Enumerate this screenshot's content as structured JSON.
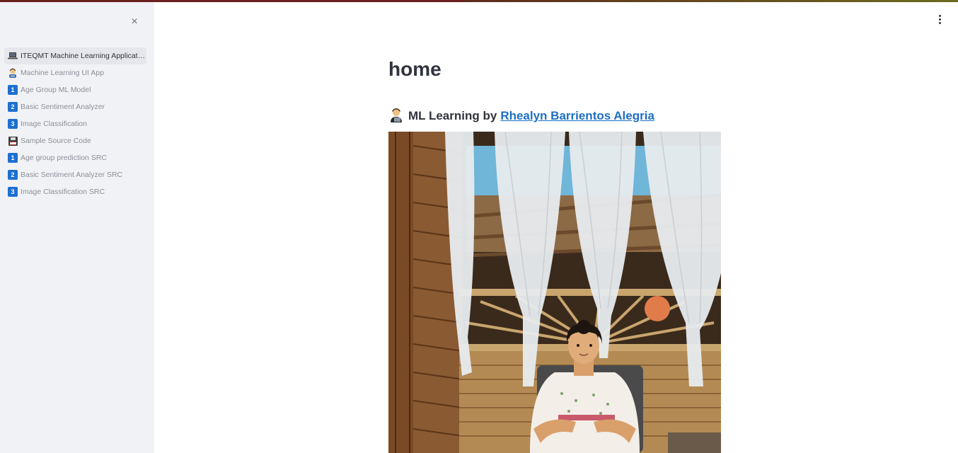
{
  "sidebar": {
    "items": [
      {
        "label": "ITEQMT Machine Learning Applicati…",
        "icon": "laptop-icon",
        "active": true
      },
      {
        "label": "Machine Learning UI App",
        "icon": "person-icon"
      },
      {
        "label": "Age Group ML Model",
        "icon": "keycap-1-icon",
        "badge": "1"
      },
      {
        "label": "Basic Sentiment Analyzer",
        "icon": "keycap-2-icon",
        "badge": "2"
      },
      {
        "label": "Image Classification",
        "icon": "keycap-3-icon",
        "badge": "3"
      },
      {
        "label": "Sample Source Code",
        "icon": "floppy-disk-icon"
      },
      {
        "label": "Age group prediction SRC",
        "icon": "keycap-1-icon",
        "badge": "1"
      },
      {
        "label": "Basic Sentiment Analyzer SRC",
        "icon": "keycap-2-icon",
        "badge": "2"
      },
      {
        "label": "Image Classification SRC",
        "icon": "keycap-3-icon",
        "badge": "3"
      }
    ],
    "close_label": "×"
  },
  "main": {
    "title": "home",
    "subtitle_prefix": "ML Learning by",
    "subtitle_link": "Rhealyn Barrientos Alegria",
    "subtitle_emoji": "🧑‍💻"
  },
  "colors": {
    "sidebar_bg": "#f0f2f6",
    "link": "#1c6fc4",
    "badge": "#1d6fd1"
  }
}
